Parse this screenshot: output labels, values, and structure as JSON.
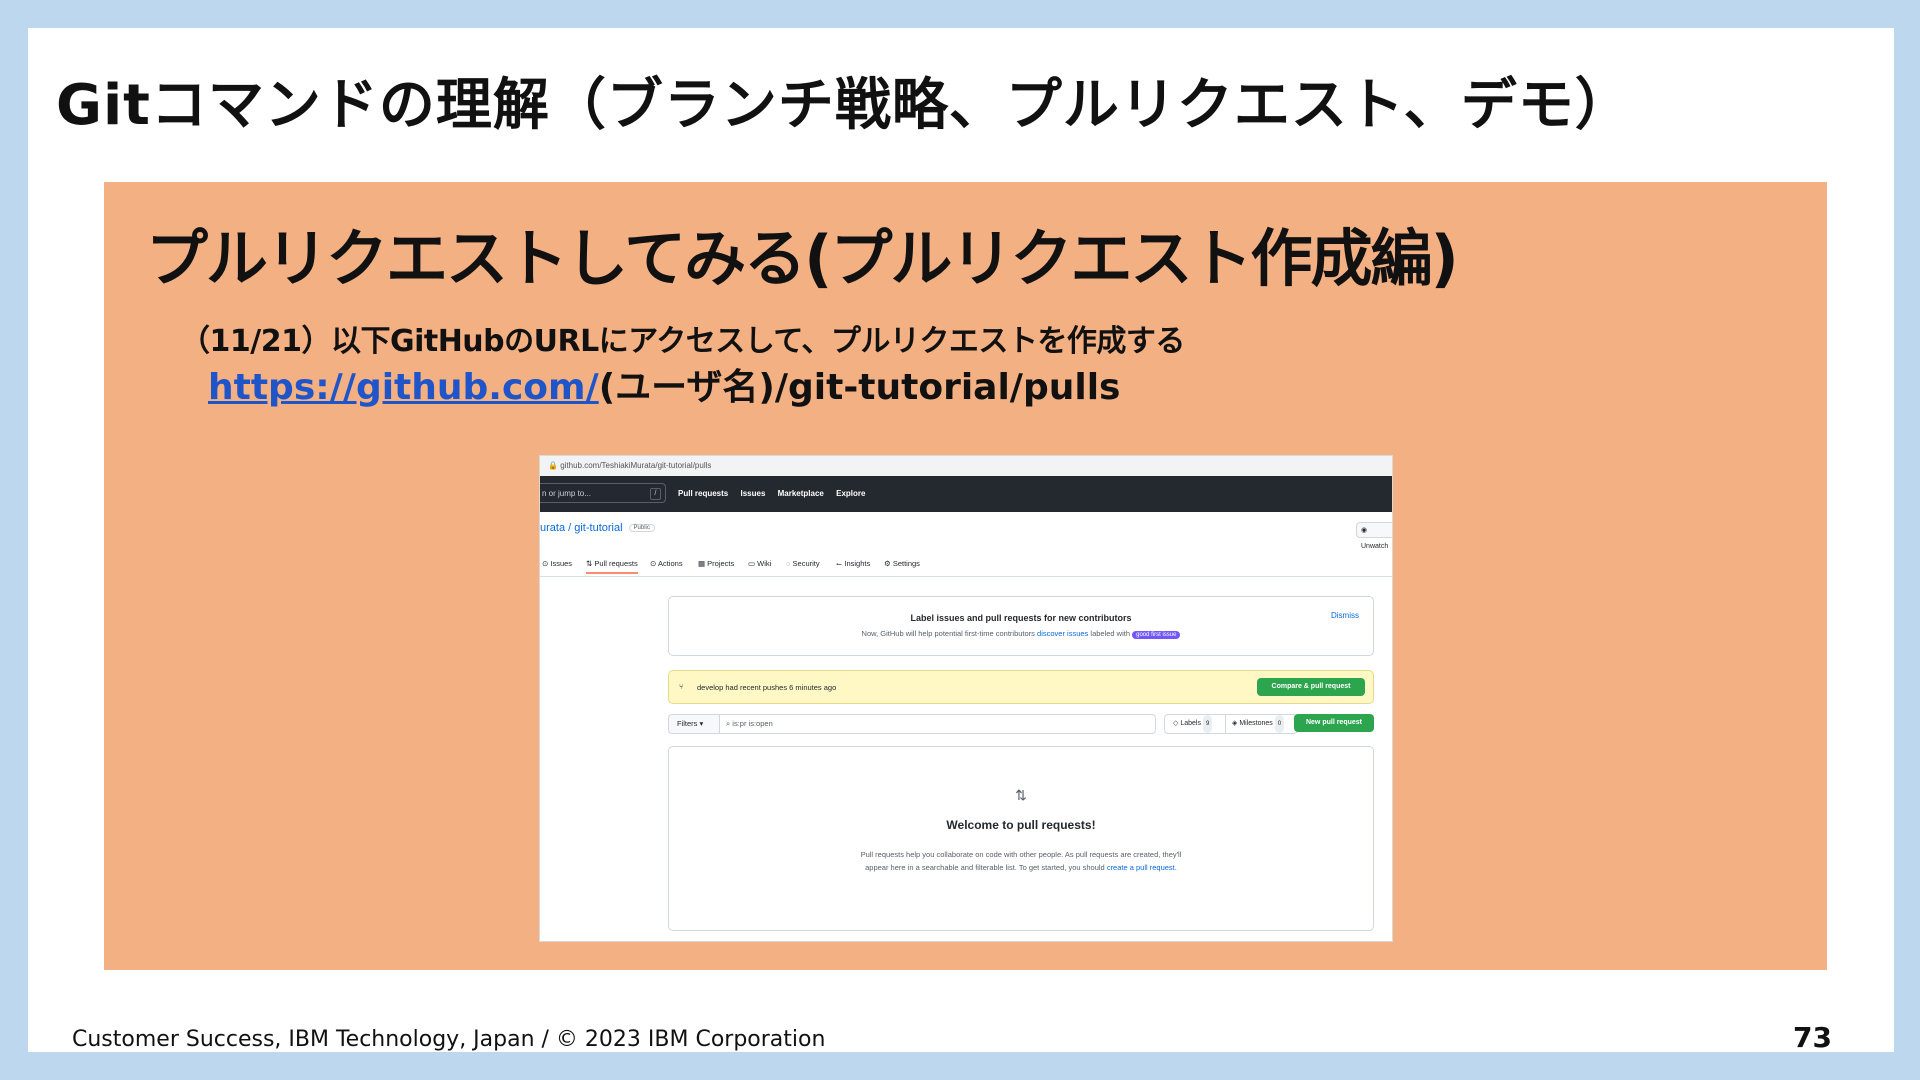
{
  "slide": {
    "title": "Gitコマンドの理解（ブランチ戦略、プルリクエスト、デモ）",
    "panel_heading": "プルリクエストしてみる(プルリクエスト作成編)",
    "step": "（11/21）以下GitHubのURLにアクセスして、プルリクエストを作成する",
    "url_link": "https://github.com/",
    "url_rest": "(ユーザ名)/git-tutorial/pulls",
    "footer": "Customer Success, IBM Technology, Japan / © 2023 IBM Corporation",
    "page_number": "73"
  },
  "screenshot": {
    "address": "github.com/TeshiakiMurata/git-tutorial/pulls",
    "nav": {
      "search_placeholder": "n or jump to...",
      "slash": "/",
      "links": [
        "Pull requests",
        "Issues",
        "Marketplace",
        "Explore"
      ]
    },
    "repo": {
      "name": "urata / git-tutorial",
      "visibility": "Public",
      "unwatch": "Unwatch"
    },
    "tabs": [
      "Issues",
      "Pull requests",
      "Actions",
      "Projects",
      "Wiki",
      "Security",
      "Insights",
      "Settings"
    ],
    "notice": {
      "title": "Label issues and pull requests for new contributors",
      "text_before": "Now, GitHub will help potential first-time contributors ",
      "link": "discover issues",
      "text_after": " labeled with",
      "label": "good first issue",
      "dismiss": "Dismiss"
    },
    "banner": {
      "text": "develop had recent pushes 6 minutes ago",
      "button": "Compare & pull request"
    },
    "filterbar": {
      "filters": "Filters",
      "query": "is:pr is:open",
      "labels": "Labels",
      "labels_count": "9",
      "milestones": "Milestones",
      "milestones_count": "0",
      "new_pr": "New pull request"
    },
    "empty": {
      "title": "Welcome to pull requests!",
      "line1": "Pull requests help you collaborate on code with other people. As pull requests are created, they'll",
      "line2_before": "appear here in a searchable and filterable list. To get started, you should ",
      "line2_link": "create a pull request",
      "line2_after": "."
    }
  }
}
